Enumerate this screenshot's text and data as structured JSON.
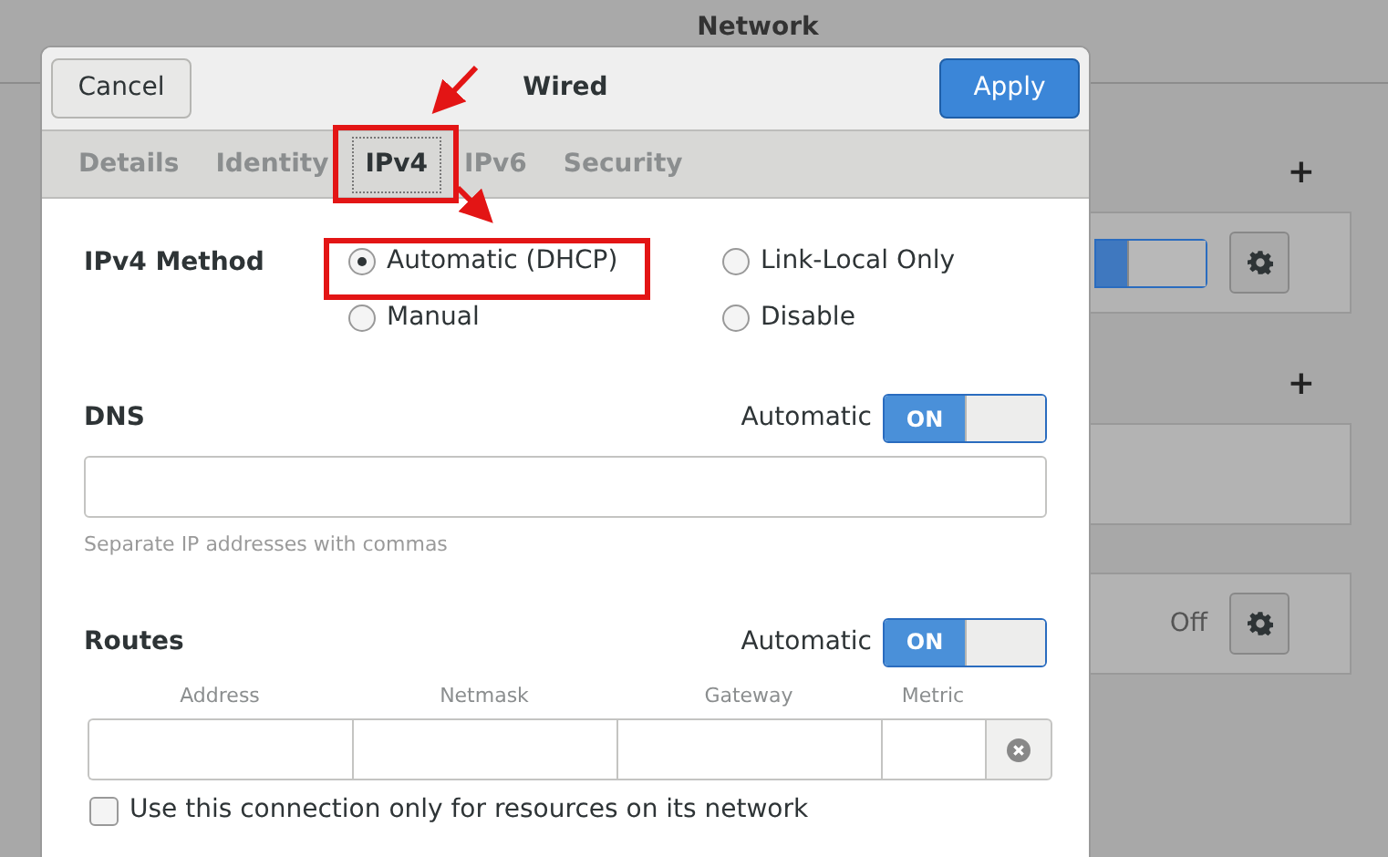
{
  "background": {
    "title": "Network",
    "sections": [
      {
        "add": "+",
        "cards": [
          {
            "kind": "switch",
            "on": true
          }
        ]
      },
      {
        "add": "+",
        "cards": [
          {
            "kind": "empty"
          },
          {
            "kind": "status",
            "status": "Off"
          }
        ]
      }
    ]
  },
  "dialog": {
    "title": "Wired",
    "cancel": "Cancel",
    "apply": "Apply",
    "tabs": [
      {
        "label": "Details",
        "selected": false
      },
      {
        "label": "Identity",
        "selected": false
      },
      {
        "label": "IPv4",
        "selected": true
      },
      {
        "label": "IPv6",
        "selected": false
      },
      {
        "label": "Security",
        "selected": false
      }
    ],
    "ipv4_method": {
      "label": "IPv4 Method",
      "options": [
        {
          "label": "Automatic (DHCP)",
          "selected": true
        },
        {
          "label": "Link-Local Only",
          "selected": false
        },
        {
          "label": "Manual",
          "selected": false
        },
        {
          "label": "Disable",
          "selected": false
        }
      ]
    },
    "dns": {
      "label": "DNS",
      "auto_label": "Automatic",
      "switch_text": "ON",
      "on": true,
      "hint": "Separate IP addresses with commas"
    },
    "routes": {
      "label": "Routes",
      "auto_label": "Automatic",
      "switch_text": "ON",
      "on": true,
      "columns": [
        "Address",
        "Netmask",
        "Gateway",
        "Metric"
      ]
    },
    "only_local": {
      "label": "Use this connection only for resources on its network",
      "checked": false
    }
  }
}
